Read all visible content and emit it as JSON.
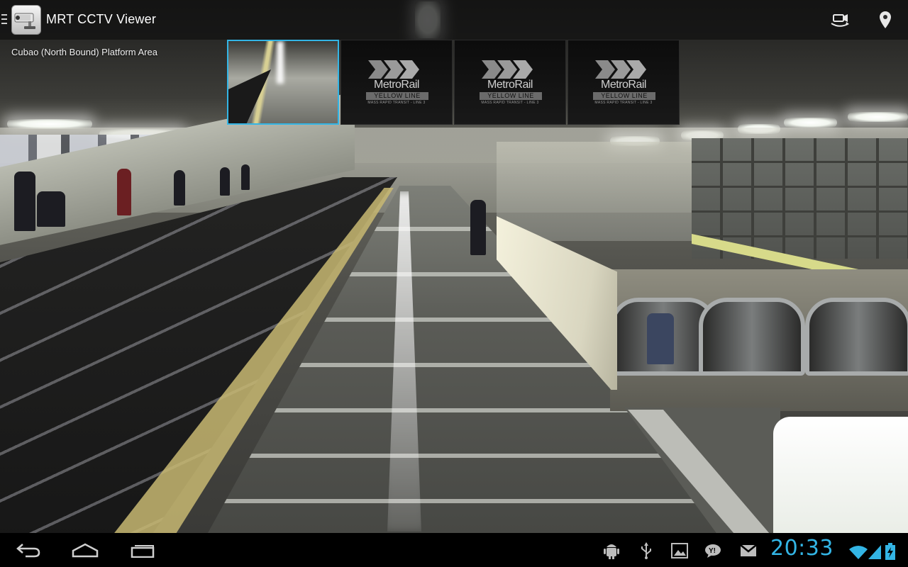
{
  "app": {
    "title": "MRT CCTV Viewer",
    "icon": "cctv-camera-icon"
  },
  "action_bar": {
    "actions": [
      {
        "icon": "switch-camera-icon"
      },
      {
        "icon": "location-pin-icon"
      }
    ]
  },
  "camera": {
    "location": "Cubao (North Bound) Platform Area"
  },
  "thumbnails": [
    {
      "type": "camera-feed",
      "selected": true
    },
    {
      "type": "logo",
      "selected": false,
      "logo_word": "MetroRail",
      "logo_line": "YELLOW LINE",
      "logo_tag": "MASS RAPID TRANSIT - LINE 3"
    },
    {
      "type": "logo",
      "selected": false,
      "logo_word": "MetroRail",
      "logo_line": "YELLOW LINE",
      "logo_tag": "MASS RAPID TRANSIT - LINE 3"
    },
    {
      "type": "logo",
      "selected": false,
      "logo_word": "MetroRail",
      "logo_line": "YELLOW LINE",
      "logo_tag": "MASS RAPID TRANSIT - LINE 3"
    }
  ],
  "system_bar": {
    "nav_buttons": [
      "back-icon",
      "home-icon",
      "recent-apps-icon"
    ],
    "notification_icons": [
      "android-debug-icon",
      "usb-icon",
      "gallery-icon",
      "yahoo-messenger-icon",
      "gmail-icon"
    ],
    "clock": "20:33",
    "status_icons": [
      "wifi-icon",
      "signal-icon",
      "battery-charging-icon"
    ]
  },
  "colors": {
    "accent": "#33b5e5",
    "action_bar_bg": "#101010",
    "nav_bar_bg": "#000000"
  }
}
